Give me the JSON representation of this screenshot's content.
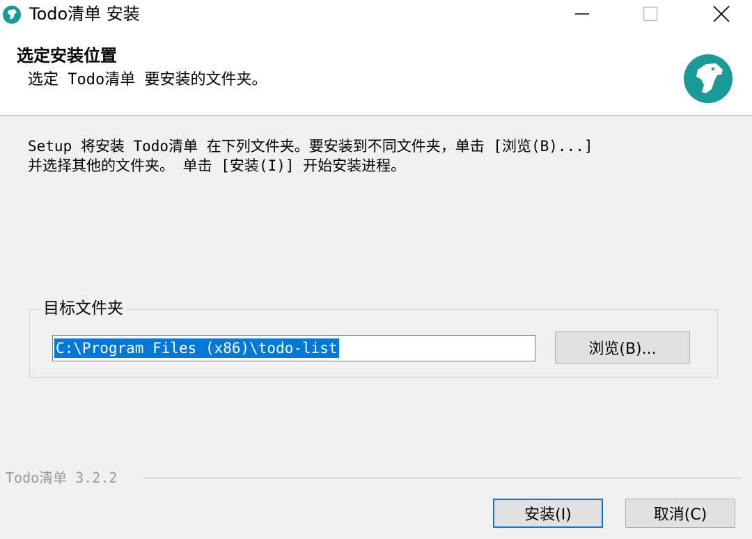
{
  "window": {
    "title": "Todo清单 安装",
    "controls": {
      "minimize_icon": "minimize-icon",
      "maximize_icon": "maximize-icon",
      "close_icon": "close-icon"
    },
    "accent_color": "#1a9a96"
  },
  "header": {
    "title": "选定安装位置",
    "subtitle": "选定 Todo清单 要安装的文件夹。",
    "logo": "horse-head-logo"
  },
  "body": {
    "description": "Setup 将安装 Todo清单 在下列文件夹。要安装到不同文件夹，单击 [浏览(B)...]\n并选择其他的文件夹。 单击 [安装(I)] 开始安装进程。"
  },
  "destination": {
    "group_label": "目标文件夹",
    "path": "C:\\Program Files (x86)\\todo-list",
    "browse_label": "浏览(B)..."
  },
  "footer": {
    "version": "Todo清单 3.2.2",
    "install_label": "安装(I)",
    "cancel_label": "取消(C)"
  }
}
